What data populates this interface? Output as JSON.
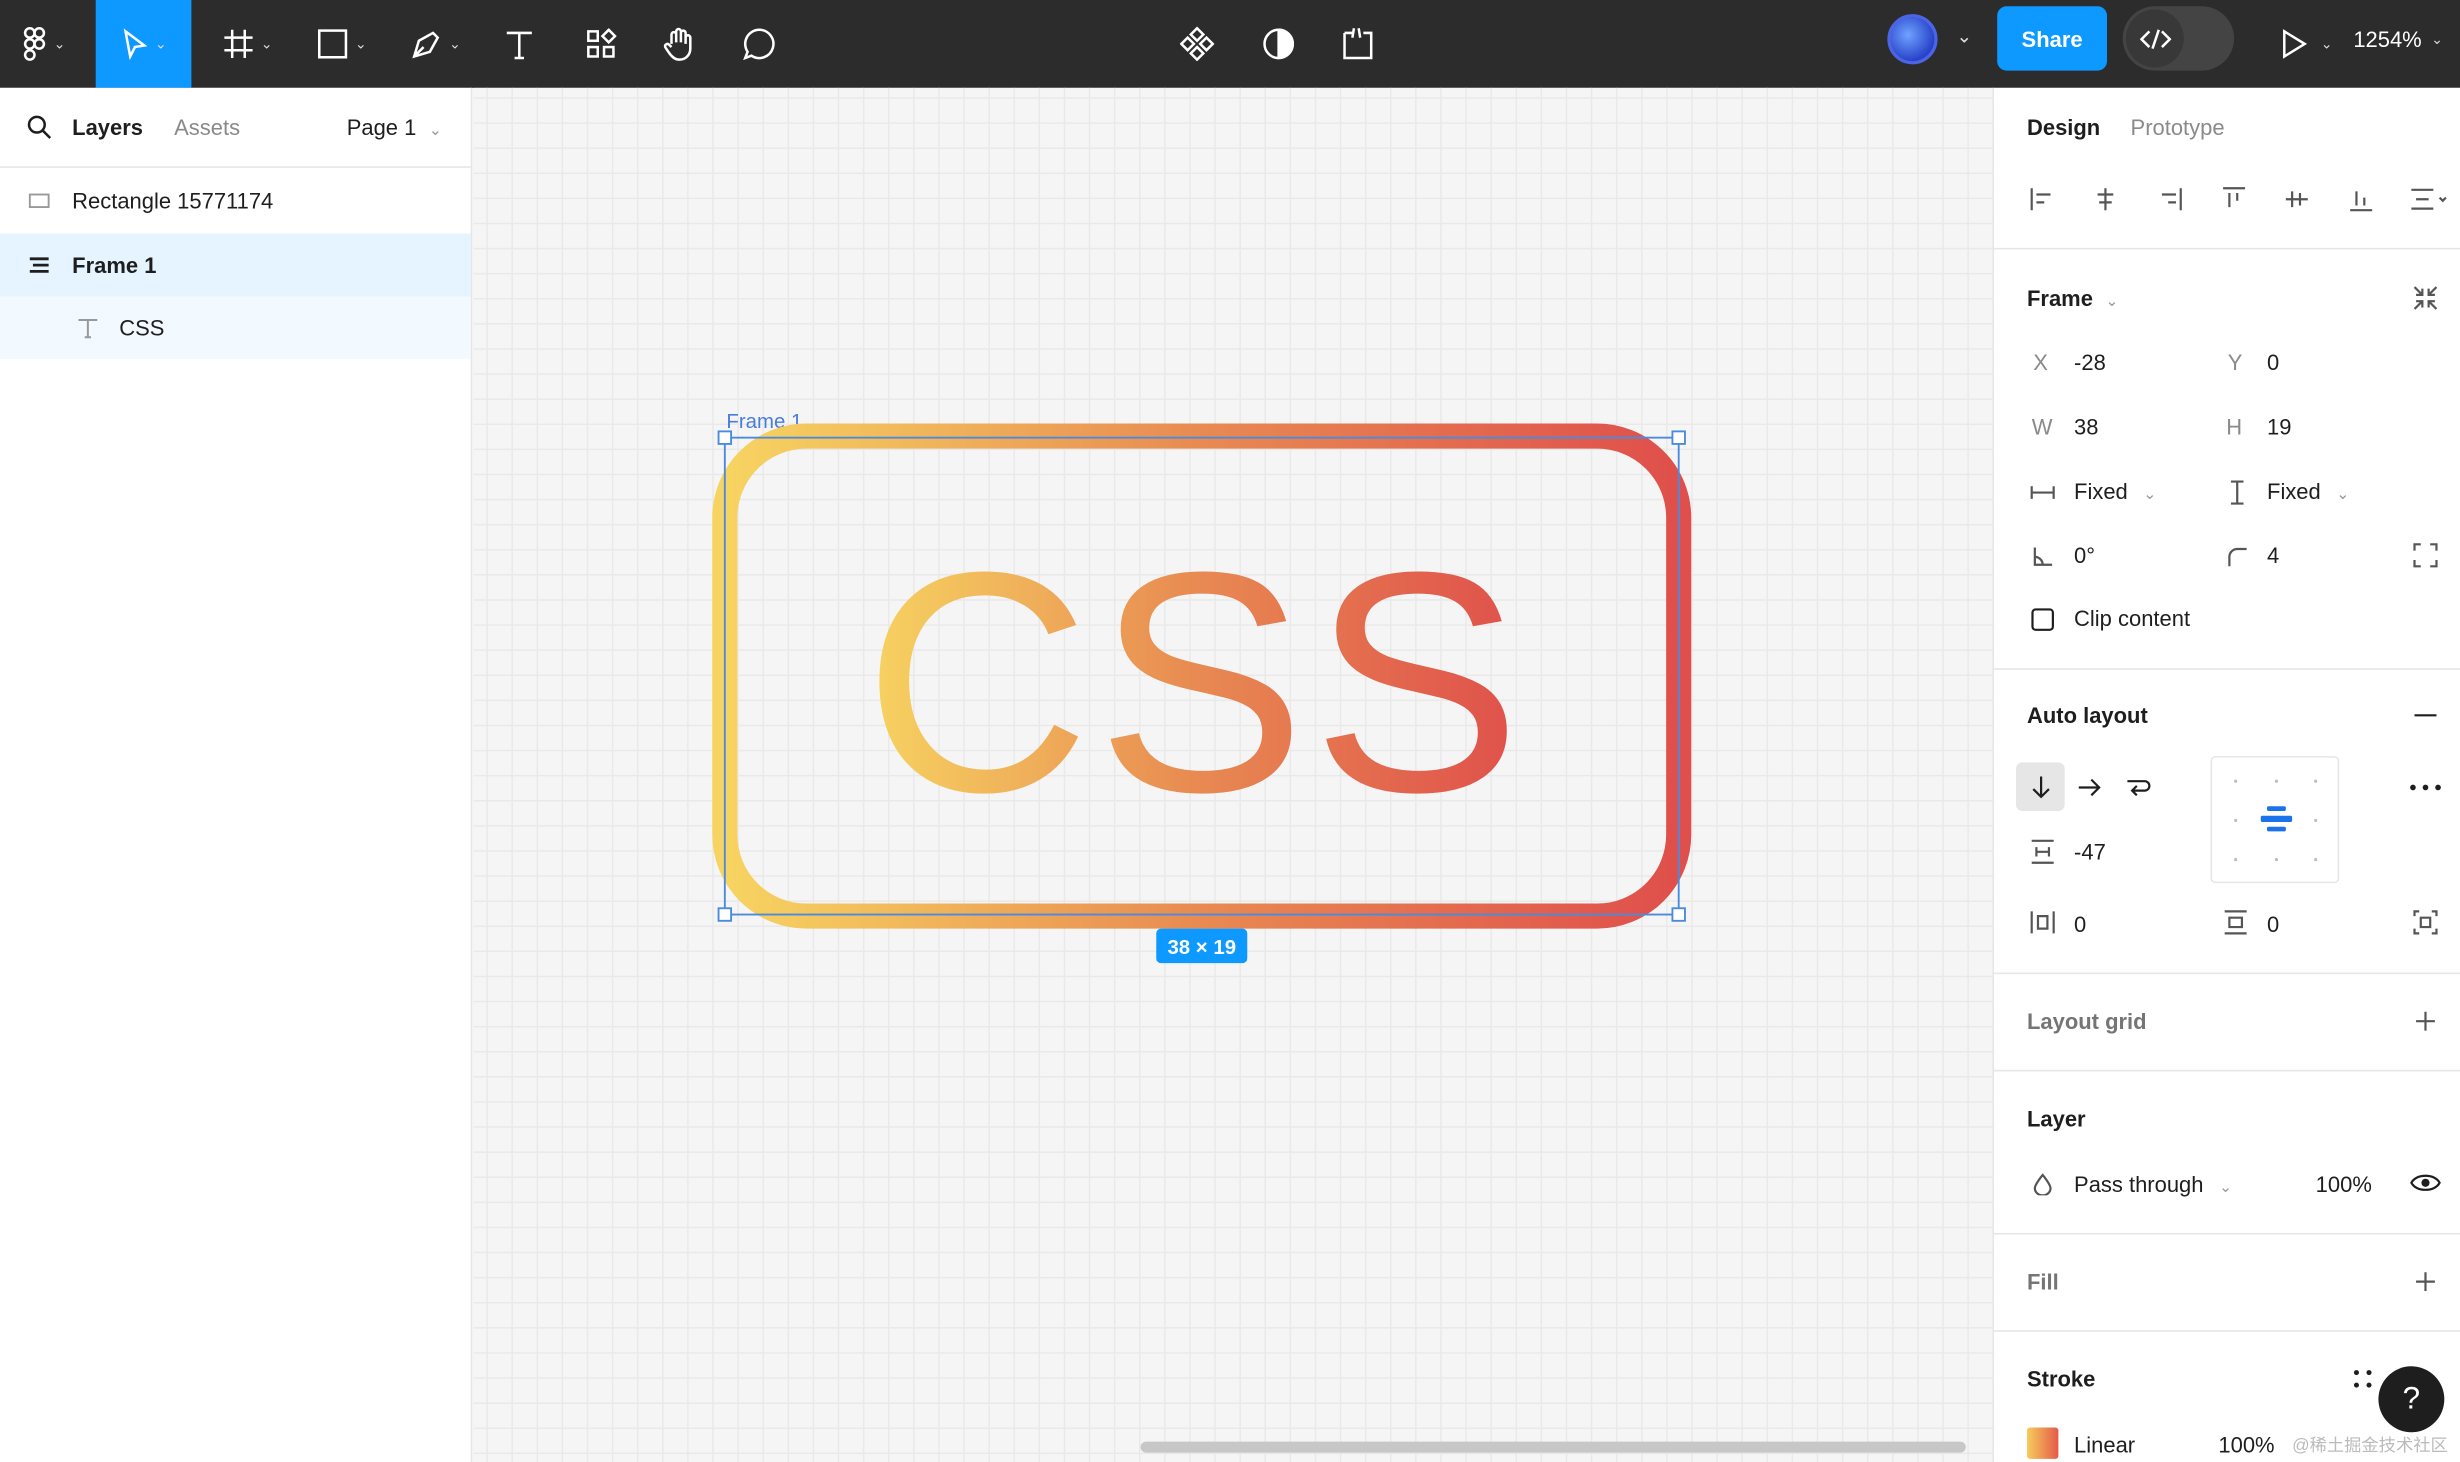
{
  "toolbar": {
    "zoom": "1254%",
    "share_label": "Share"
  },
  "left_panel": {
    "tabs": [
      "Layers",
      "Assets"
    ],
    "page_selector": "Page 1",
    "layers": [
      {
        "name": "Rectangle 15771174",
        "type": "rectangle"
      },
      {
        "name": "Frame 1",
        "type": "auto-layout-frame",
        "selected": true
      },
      {
        "name": "CSS",
        "type": "text"
      }
    ]
  },
  "canvas": {
    "frame_label": "Frame 1",
    "size_badge": "38 × 19",
    "text": "CSS",
    "gradient_colors": [
      "#f6d35e",
      "#e8884f",
      "#e0504a"
    ]
  },
  "right_panel": {
    "tabs": [
      "Design",
      "Prototype"
    ],
    "frame": {
      "title": "Frame",
      "x_label": "X",
      "x": "-28",
      "y_label": "Y",
      "y": "0",
      "w_label": "W",
      "w": "38",
      "h_label": "H",
      "h": "19",
      "width_mode": "Fixed",
      "height_mode": "Fixed",
      "rotation": "0°",
      "radius": "4",
      "clip_content": "Clip content"
    },
    "auto_layout": {
      "title": "Auto layout",
      "gap": "-47",
      "padding_h": "0",
      "padding_v": "0"
    },
    "layout_grid": {
      "title": "Layout grid"
    },
    "layer": {
      "title": "Layer",
      "blend": "Pass through",
      "opacity": "100%"
    },
    "fill": {
      "title": "Fill"
    },
    "stroke": {
      "title": "Stroke",
      "type": "Linear",
      "opacity": "100%"
    },
    "watermark": "@稀土掘金技术社区"
  },
  "colors": {
    "accent": "#0d99ff",
    "toolbar_bg": "#2c2c2c"
  }
}
